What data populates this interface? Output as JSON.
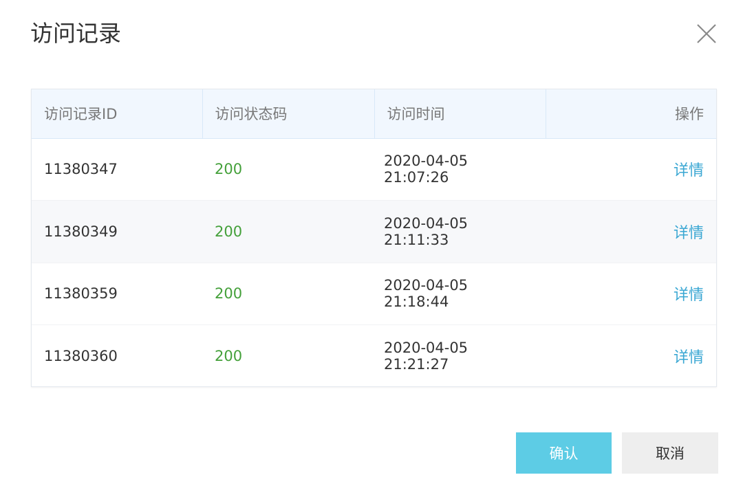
{
  "dialog": {
    "title": "访问记录",
    "close_icon": "close-icon"
  },
  "table": {
    "headers": [
      "访问记录ID",
      "访问状态码",
      "访问时间",
      "操作"
    ],
    "rows": [
      {
        "id": "11380347",
        "status": "200",
        "time": "2020-04-05 21:07:26",
        "action": "详情"
      },
      {
        "id": "11380349",
        "status": "200",
        "time": "2020-04-05 21:11:33",
        "action": "详情"
      },
      {
        "id": "11380359",
        "status": "200",
        "time": "2020-04-05 21:18:44",
        "action": "详情"
      },
      {
        "id": "11380360",
        "status": "200",
        "time": "2020-04-05 21:21:27",
        "action": "详情"
      }
    ]
  },
  "footer": {
    "confirm_label": "确认",
    "cancel_label": "取消"
  },
  "colors": {
    "status_ok": "#44a03a",
    "link": "#3aa7d3",
    "confirm_bg": "#5dcce5",
    "header_bg": "#f1f7fe"
  }
}
